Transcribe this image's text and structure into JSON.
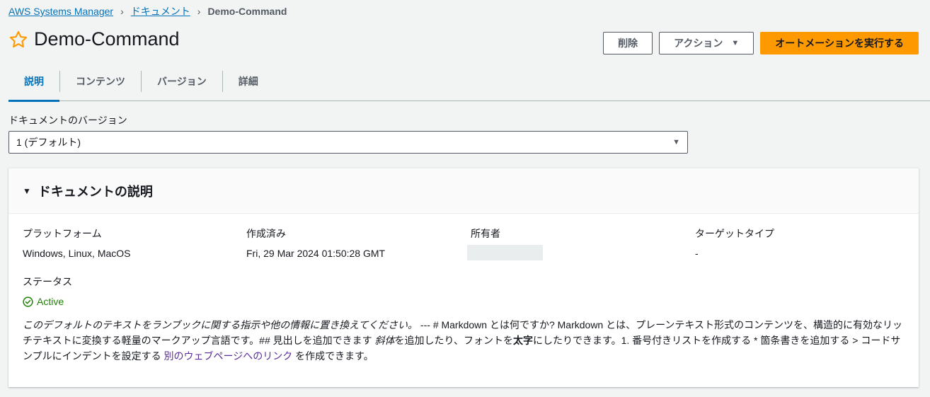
{
  "breadcrumb": {
    "root": "AWS Systems Manager",
    "documents": "ドキュメント",
    "current": "Demo-Command"
  },
  "page_title": "Demo-Command",
  "buttons": {
    "delete": "削除",
    "actions": "アクション",
    "run_automation": "オートメーションを実行する"
  },
  "tabs": [
    "説明",
    "コンテンツ",
    "バージョン",
    "詳細"
  ],
  "version_field": {
    "label": "ドキュメントのバージョン",
    "value": "1 (デフォルト)"
  },
  "panel": {
    "title": "ドキュメントの説明",
    "platform_label": "プラットフォーム",
    "platform_value": "Windows, Linux, MacOS",
    "created_label": "作成済み",
    "created_value": "Fri, 29 Mar 2024 01:50:28 GMT",
    "owner_label": "所有者",
    "target_label": "ターゲットタイプ",
    "target_value": "-",
    "status_label": "ステータス",
    "status_value": "Active"
  },
  "description": {
    "italic_intro": "このデフォルトのテキストをランブックに関する指示や他の情報に置き換えてください。",
    "part1": " --- # Markdown とは何ですか? Markdown とは、プレーンテキスト形式のコンテンツを、構造的に有効なリッチテキストに変換する軽量のマークアップ言語です。## 見出しを追加できます ",
    "italic_word": "斜体",
    "part2": "を追加したり、フォントを",
    "bold_word": "太字",
    "part3": "にしたりできます。1. 番号付きリストを作成する * 箇条書きを追加する > コードサンプルにインデントを設定する ",
    "link": "別のウェブページへのリンク",
    "part4": " を作成できます。"
  },
  "colors": {
    "link": "#0073bb",
    "primary_button": "#ff9900",
    "status_active": "#1d8102",
    "star": "#ff9900"
  }
}
